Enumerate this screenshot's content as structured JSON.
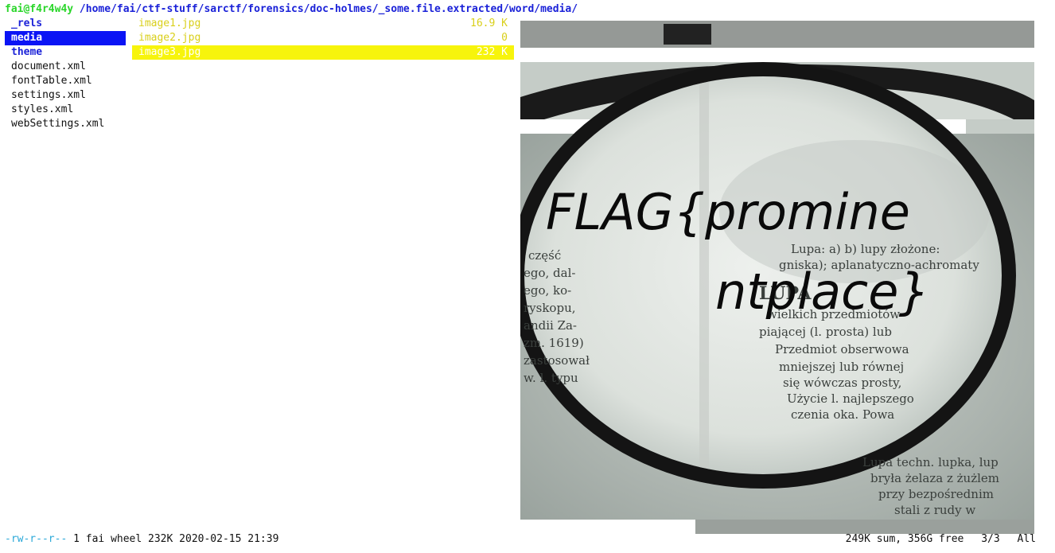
{
  "header": {
    "user_host": "fai@f4r4w4y",
    "path": "/home/fai/ctf-stuff/sarctf/forensics/doc-holmes/_some.file.extracted/word/media/"
  },
  "parent_list": [
    {
      "name": "_rels",
      "type": "dir",
      "selected": false
    },
    {
      "name": "media",
      "type": "dir",
      "selected": true
    },
    {
      "name": "theme",
      "type": "dir",
      "selected": false
    },
    {
      "name": "document.xml",
      "type": "file",
      "selected": false
    },
    {
      "name": "fontTable.xml",
      "type": "file",
      "selected": false
    },
    {
      "name": "settings.xml",
      "type": "file",
      "selected": false
    },
    {
      "name": "styles.xml",
      "type": "file",
      "selected": false
    },
    {
      "name": "webSettings.xml",
      "type": "file",
      "selected": false
    }
  ],
  "file_list": [
    {
      "name": "image1.jpg",
      "size": "16.9 K",
      "selected": false
    },
    {
      "name": "image2.jpg",
      "size": "0",
      "selected": false
    },
    {
      "name": "image3.jpg",
      "size": "232 K",
      "selected": true
    }
  ],
  "preview": {
    "flag_text_line1": "FLAG{promine",
    "flag_text_line2": "ntplace}",
    "book_text": [
      "Lupa: a) b) lupy złożone:",
      "gniska); aplanatyczno-achromaty",
      "LUPA",
      "wielkich przedmiotów",
      "piającej (l. prosta) lub",
      "Przedmiot obserwowa",
      "mniejszej lub równej",
      "się wówczas prosty,",
      "Użycie l. najlepszego",
      "czenia oka. Powa",
      "Lupa techn. lupka, lup",
      "bryła żelaza z żużlem",
      "przy bezpośrednim",
      "stali z rudy w",
      "część",
      "ego, dal-",
      "ego, ko-",
      "ryskopu,",
      "andii Za-",
      "zm. 1619)",
      "zastosował",
      "w. l. typu"
    ],
    "colors": {
      "lens_rim": "#151515",
      "paper": "#dfe3df",
      "paper_shadow": "#b9c1bd"
    }
  },
  "status": {
    "permissions": "-rw-r--r--",
    "info": "1 fai wheel 232K 2020-02-15 21:39",
    "summary": "249K sum, 356G free",
    "position": "3/3",
    "scroll": "All"
  }
}
